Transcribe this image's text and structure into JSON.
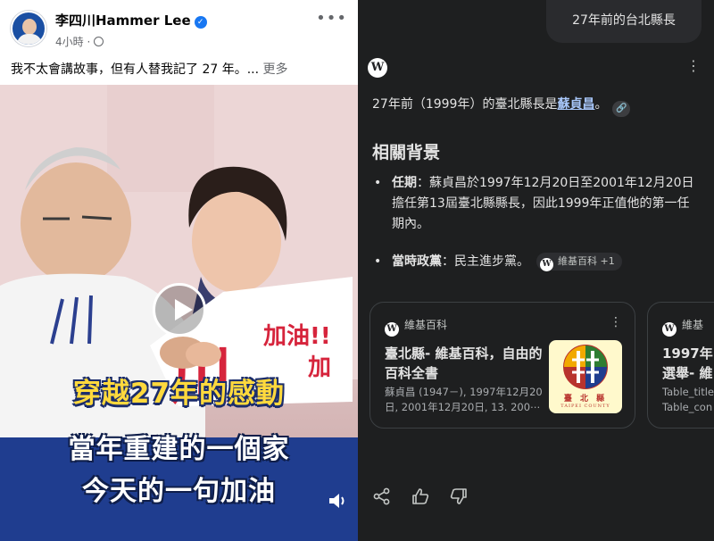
{
  "post": {
    "author": "李四川Hammer Lee",
    "time": "4小時",
    "caption": "我不太會講故事，但有人替我記了 27 年。...",
    "caption_more": "更多",
    "video": {
      "sign_1": "加油!!",
      "sign_2": "加",
      "sign_3": "川",
      "title_1": "穿越27年的感動",
      "title_2": "當年重建的一個家",
      "title_3": "今天的一句加油"
    }
  },
  "assistant": {
    "query": "27年前的台北縣長",
    "answer_prefix": "27年前（1999年）的臺北縣長是",
    "answer_link": "蘇貞昌",
    "answer_suffix": "。",
    "section_title": "相關背景",
    "bullets": [
      {
        "label": "任期",
        "text": "：蘇貞昌於1997年12月20日至2001年12月20日擔任第13屆臺北縣縣長，因此1999年正值他的第一任期內。"
      },
      {
        "label": "當時政黨",
        "text": "：民主進步黨。",
        "source": "維基百科 +1"
      }
    ],
    "cards": [
      {
        "source": "維基百科",
        "title": "臺北縣- 維基百科，自由的百科全書",
        "snippet": "蘇貞昌 (1947－), 1997年12月20日, 2001年12月20日, 13. 200⋯",
        "thumb_text": "臺 北 縣",
        "thumb_sub": "TAIPEI COUNTY"
      },
      {
        "source": "維基",
        "title": "1997年",
        "title_2": "選舉- 維",
        "snippet": "Table_title",
        "snippet_2": "Table_con"
      }
    ]
  },
  "colors": {
    "page_bg": "#1e1f20",
    "link": "#a8c7fa",
    "fb_verified": "#1877f2",
    "video_band": "#1f3d8f",
    "title_yellow": "#ffd93d"
  },
  "icons": [
    "verified-badge-icon",
    "globe-icon",
    "more-icon",
    "play-icon",
    "volume-icon",
    "wikipedia-icon",
    "link-icon",
    "kebab-icon",
    "share-icon",
    "thumbs-up-icon",
    "thumbs-down-icon"
  ]
}
